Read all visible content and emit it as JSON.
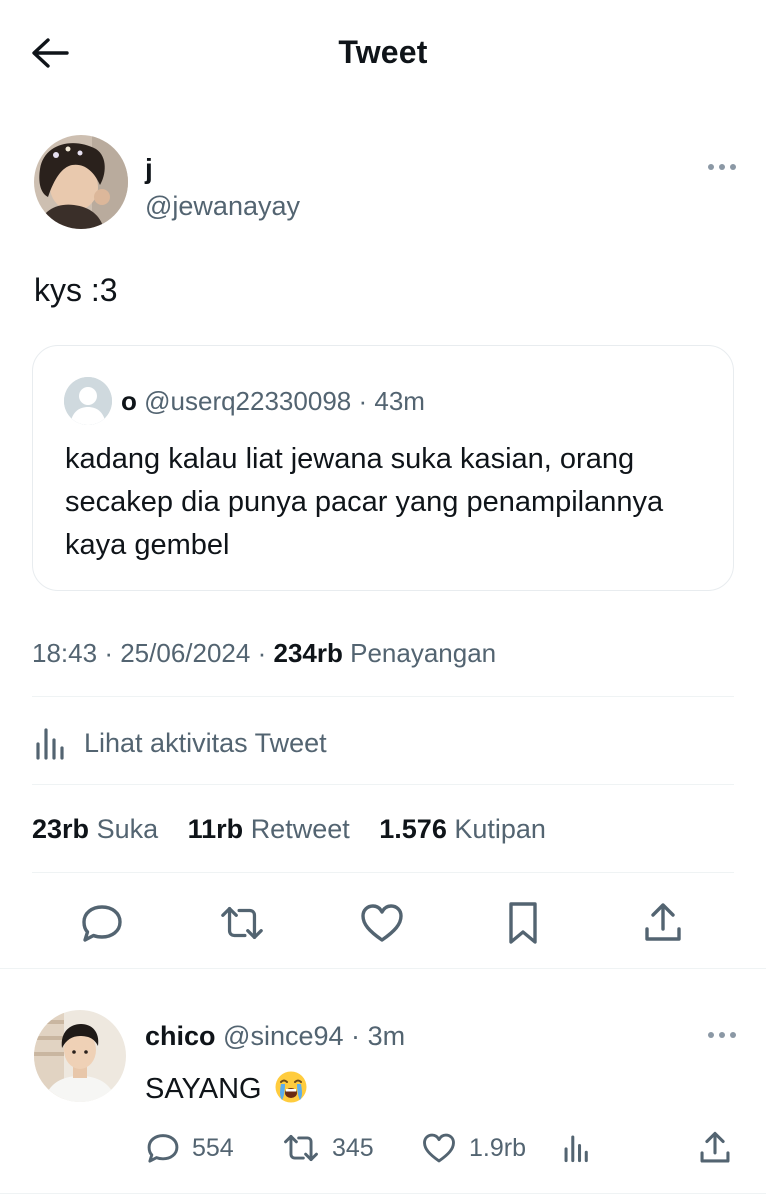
{
  "header": {
    "title": "Tweet"
  },
  "tweet": {
    "author_name": "j",
    "author_handle": "@jewanayay",
    "text": "kys :3",
    "quote": {
      "name": "o",
      "handle": "@userq22330098",
      "separator": "·",
      "time": "43m",
      "text": "kadang kalau liat jewana suka kasian, orang secakep dia punya pacar yang penampilannya kaya gembel"
    },
    "time": "18:43",
    "date": "25/06/2024",
    "views_count": "234rb",
    "views_label": "Penayangan",
    "separator": "·"
  },
  "activity": {
    "label": "Lihat aktivitas Tweet"
  },
  "stats": {
    "likes_count": "23rb",
    "likes_label": "Suka",
    "retweets_count": "11rb",
    "retweets_label": "Retweet",
    "quotes_count": "1.576",
    "quotes_label": "Kutipan"
  },
  "reply": {
    "name": "chico",
    "handle": "@since94",
    "separator": "·",
    "time": "3m",
    "text": "SAYANG",
    "replies": "554",
    "retweets": "345",
    "likes": "1.9rb"
  },
  "icons": {
    "back": "arrow-left-icon",
    "more": "more-horizontal-icon",
    "reply": "reply-icon",
    "retweet": "retweet-icon",
    "like": "heart-icon",
    "bookmark": "bookmark-icon",
    "share": "share-icon",
    "analytics": "bar-chart-icon",
    "emoji": "loudly-crying-face-icon"
  },
  "colors": {
    "text": "#0f1419",
    "secondary": "#536471",
    "border": "#eff3f4"
  }
}
